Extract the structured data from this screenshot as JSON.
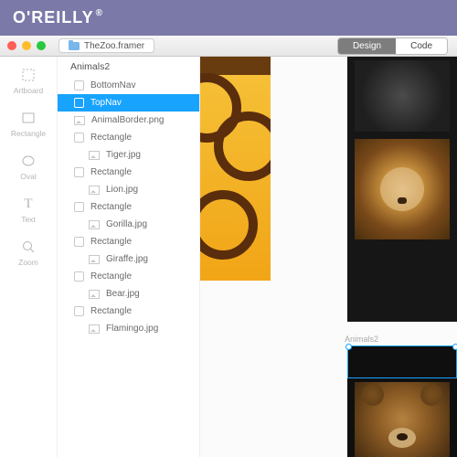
{
  "brand": "O'REILLY",
  "titlebar": {
    "filename": "TheZoo.framer"
  },
  "segmented": {
    "design": "Design",
    "code": "Code"
  },
  "tools": [
    {
      "id": "artboard-tool",
      "label": "Artboard"
    },
    {
      "id": "rectangle-tool",
      "label": "Rectangle"
    },
    {
      "id": "oval-tool",
      "label": "Oval"
    },
    {
      "id": "text-tool",
      "label": "Text"
    },
    {
      "id": "zoom-tool",
      "label": "Zoom"
    }
  ],
  "layers": {
    "root": "Animals2",
    "items": [
      {
        "name": "BottomNav",
        "depth": 1,
        "kind": "rect",
        "selected": false
      },
      {
        "name": "TopNav",
        "depth": 1,
        "kind": "rect",
        "selected": true
      },
      {
        "name": "AnimalBorder.png",
        "depth": 1,
        "kind": "img",
        "selected": false
      },
      {
        "name": "Rectangle",
        "depth": 1,
        "kind": "rect",
        "selected": false
      },
      {
        "name": "Tiger.jpg",
        "depth": 2,
        "kind": "img",
        "selected": false
      },
      {
        "name": "Rectangle",
        "depth": 1,
        "kind": "rect",
        "selected": false
      },
      {
        "name": "Lion.jpg",
        "depth": 2,
        "kind": "img",
        "selected": false
      },
      {
        "name": "Rectangle",
        "depth": 1,
        "kind": "rect",
        "selected": false
      },
      {
        "name": "Gorilla.jpg",
        "depth": 2,
        "kind": "img",
        "selected": false
      },
      {
        "name": "Rectangle",
        "depth": 1,
        "kind": "rect",
        "selected": false
      },
      {
        "name": "Giraffe.jpg",
        "depth": 2,
        "kind": "img",
        "selected": false
      },
      {
        "name": "Rectangle",
        "depth": 1,
        "kind": "rect",
        "selected": false
      },
      {
        "name": "Bear.jpg",
        "depth": 2,
        "kind": "img",
        "selected": false
      },
      {
        "name": "Rectangle",
        "depth": 1,
        "kind": "rect",
        "selected": false
      },
      {
        "name": "Flamingo.jpg",
        "depth": 2,
        "kind": "img",
        "selected": false
      }
    ]
  },
  "canvas": {
    "artboard2_label": "Animals2"
  }
}
